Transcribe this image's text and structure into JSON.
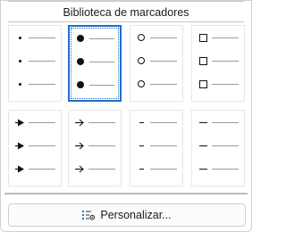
{
  "section_title": "Biblioteca de marcadores",
  "customize_button_label": "Personalizar...",
  "selected_index": 1,
  "bullet_styles": [
    {
      "name": "small-dot",
      "icon": "small-dot"
    },
    {
      "name": "big-dot",
      "icon": "big-dot"
    },
    {
      "name": "hollow-circle",
      "icon": "hollow-circle"
    },
    {
      "name": "hollow-square",
      "icon": "hollow-square"
    },
    {
      "name": "arrowhead",
      "icon": "arrowhead"
    },
    {
      "name": "arrow",
      "icon": "arrow"
    },
    {
      "name": "dash",
      "icon": "dash"
    },
    {
      "name": "long-dash",
      "icon": "long-dash"
    }
  ],
  "colors": {
    "selection": "#1f6fc8",
    "marker": "#111111",
    "line": "#9a9a9a"
  }
}
